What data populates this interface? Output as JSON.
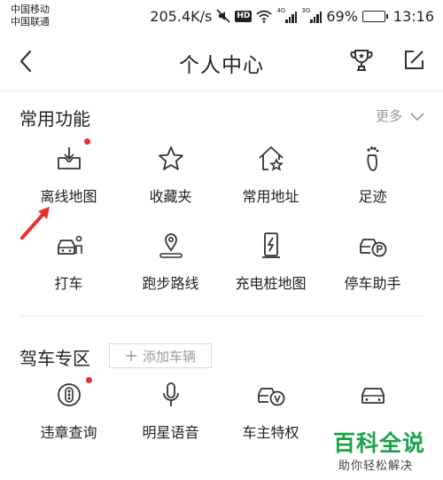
{
  "status_bar": {
    "carrier_1": "中国移动",
    "carrier_2": "中国联通",
    "speed": "205.4K/s",
    "hd": "HD",
    "sim1_tag": "4G",
    "sim2_tag": "3G",
    "battery_percent": "69%",
    "battery_level": 0.69,
    "time": "13:16"
  },
  "nav": {
    "title": "个人中心",
    "icons": [
      "back-arrow-icon",
      "trophy-icon",
      "edit-icon"
    ]
  },
  "common": {
    "title": "常用功能",
    "more_label": "更多",
    "items": [
      {
        "label": "离线地图",
        "icon": "offline-map-icon",
        "badge": true
      },
      {
        "label": "收藏夹",
        "icon": "star-icon",
        "badge": false
      },
      {
        "label": "常用地址",
        "icon": "home-star-icon",
        "badge": false
      },
      {
        "label": "足迹",
        "icon": "footprint-icon",
        "badge": false
      },
      {
        "label": "打车",
        "icon": "taxi-icon",
        "badge": false
      },
      {
        "label": "跑步路线",
        "icon": "running-route-icon",
        "badge": false
      },
      {
        "label": "充电桩地图",
        "icon": "charging-pile-icon",
        "badge": false
      },
      {
        "label": "停车助手",
        "icon": "parking-icon",
        "badge": false
      }
    ]
  },
  "driving": {
    "title": "驾车专区",
    "add_car_label": "添加车辆",
    "items": [
      {
        "label": "违章查询",
        "icon": "violation-query-icon",
        "badge": true
      },
      {
        "label": "明星语音",
        "icon": "microphone-icon",
        "badge": false
      },
      {
        "label": "车主特权",
        "icon": "vip-car-icon",
        "badge": false
      },
      {
        "label": "",
        "icon": "car-icon",
        "badge": false
      }
    ]
  },
  "watermark": {
    "title": "百科全说",
    "subtitle": "助你轻松解决"
  },
  "colors": {
    "badge": "#e5312b",
    "arrow": "#e5312b",
    "watermark_green": "#1aa34a",
    "muted": "#999999"
  }
}
